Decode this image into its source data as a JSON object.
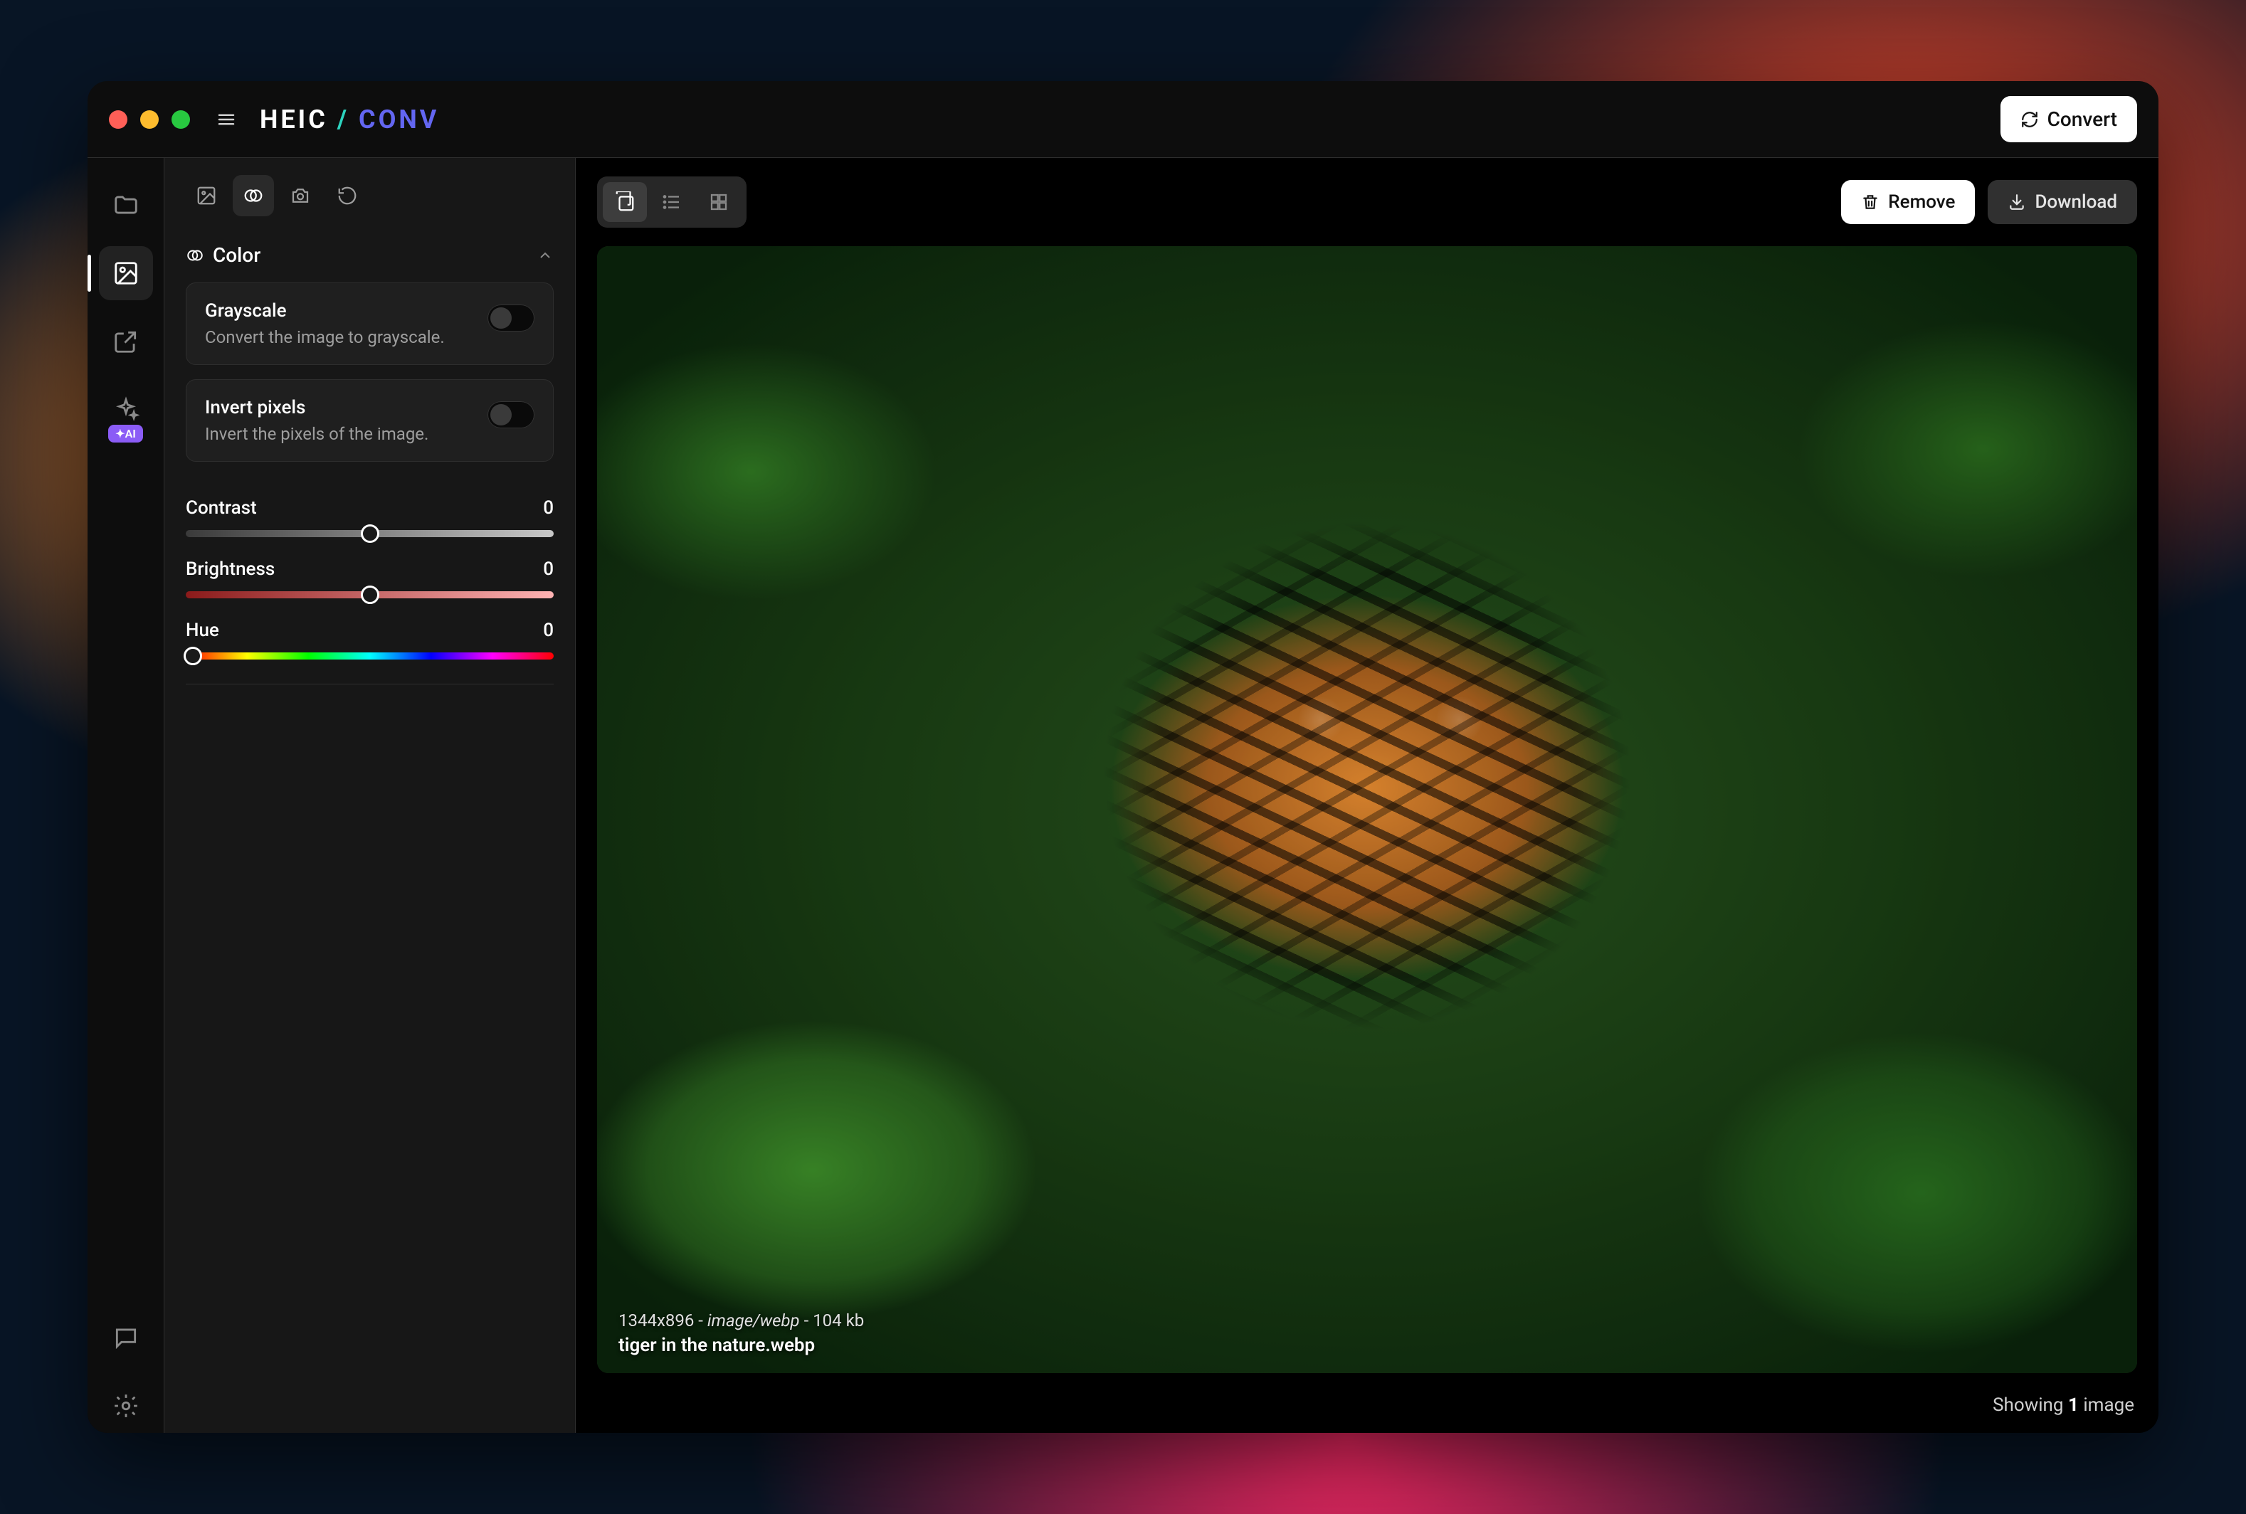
{
  "header": {
    "logo_a": "HEIC",
    "logo_sep": "/",
    "logo_b": "CONV",
    "convert_label": "Convert"
  },
  "rail": {
    "ai_badge": "✦AI"
  },
  "side": {
    "section_title": "Color",
    "grayscale": {
      "title": "Grayscale",
      "desc": "Convert the image to grayscale."
    },
    "invert": {
      "title": "Invert pixels",
      "desc": "Invert the pixels of the image."
    },
    "contrast": {
      "label": "Contrast",
      "value": "0",
      "pos": 50
    },
    "brightness": {
      "label": "Brightness",
      "value": "0",
      "pos": 50
    },
    "hue": {
      "label": "Hue",
      "value": "0",
      "pos": 2
    }
  },
  "toolbar": {
    "remove_label": "Remove",
    "download_label": "Download"
  },
  "image": {
    "dimensions": "1344x896",
    "mime": "image/webp",
    "size": "104 kb",
    "filename": "tiger in the nature.webp",
    "sep": " - "
  },
  "status": {
    "prefix": "Showing ",
    "count": "1",
    "suffix": " image"
  }
}
